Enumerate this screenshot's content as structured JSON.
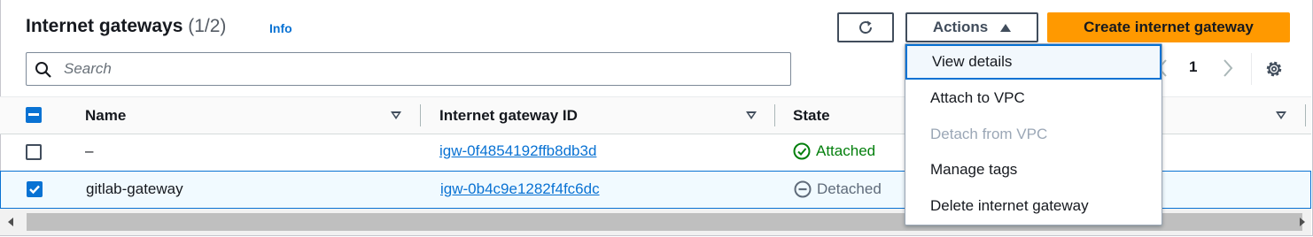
{
  "header": {
    "title": "Internet gateways",
    "count": "(1/2)",
    "info": "Info"
  },
  "toolbar": {
    "actions_label": "Actions",
    "create_label": "Create internet gateway"
  },
  "search": {
    "placeholder": "Search"
  },
  "pagination": {
    "current_page": "1"
  },
  "table": {
    "columns": [
      "Name",
      "Internet gateway ID",
      "State"
    ],
    "rows": [
      {
        "name": "–",
        "gateway_id": "igw-0f4854192ffb8db3d",
        "state": "Attached",
        "selected": false
      },
      {
        "name": "gitlab-gateway",
        "gateway_id": "igw-0b4c9e1282f4fc6dc",
        "state": "Detached",
        "selected": true
      }
    ]
  },
  "actions_menu": {
    "items": [
      {
        "label": "View details",
        "state": "focused"
      },
      {
        "label": "Attach to VPC",
        "state": "enabled"
      },
      {
        "label": "Detach from VPC",
        "state": "disabled"
      },
      {
        "label": "Manage tags",
        "state": "enabled"
      },
      {
        "label": "Delete internet gateway",
        "state": "enabled"
      }
    ]
  },
  "colors": {
    "accent": "#0972d3",
    "primary_button": "#ff9900",
    "success": "#037f0c",
    "muted": "#5f6b7a"
  },
  "icons": [
    "refresh-icon",
    "caret-up-icon",
    "search-icon",
    "chevron-left-icon",
    "chevron-right-icon",
    "settings-gear-icon",
    "sort-icon",
    "check-circle-icon",
    "minus-circle-icon"
  ]
}
